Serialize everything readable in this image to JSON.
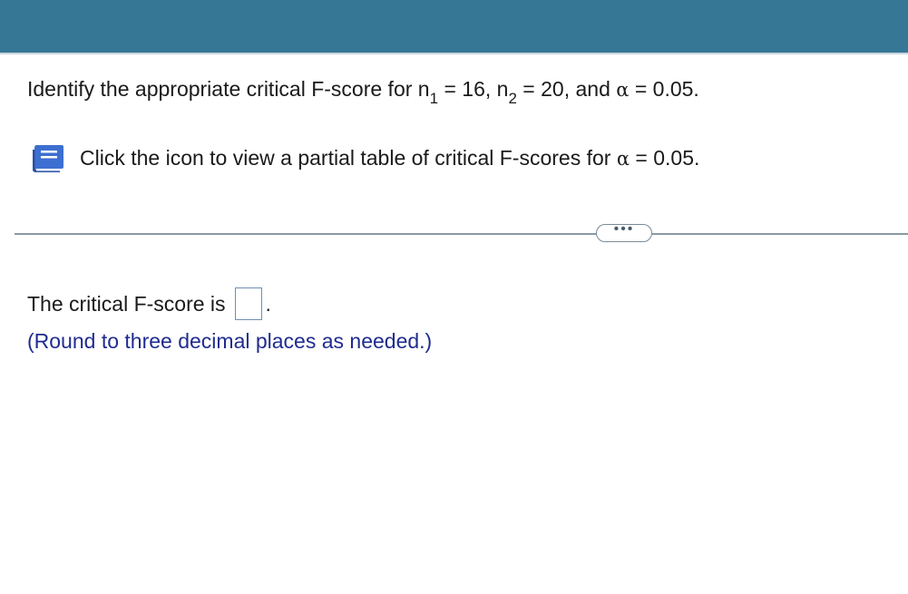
{
  "question": {
    "intro": "Identify the appropriate critical F-score for n",
    "n1_sub": "1",
    "n1_value": " = 16, n",
    "n2_sub": "2",
    "n2_value": " = 20, and ",
    "alpha_symbol": "α",
    "alpha_value": " = 0.05."
  },
  "hint": {
    "icon": "book-icon",
    "text_before_alpha": "Click the icon to view a partial table of critical F-scores for ",
    "alpha_symbol": "α",
    "text_after_alpha": " = 0.05."
  },
  "divider": {
    "more_label": "•••"
  },
  "answer": {
    "prompt": "The critical F-score is",
    "value": "",
    "suffix": "."
  },
  "note": "(Round to three decimal places as needed.)",
  "colors": {
    "topbar": "#357795",
    "note_text": "#1f2c8f",
    "icon_blue": "#3d6fd1"
  }
}
